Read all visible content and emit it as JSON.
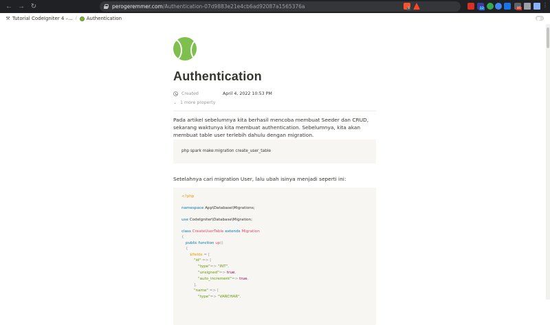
{
  "browser": {
    "url_host": "perogeremmer.com",
    "url_path": "/Authentication-07d9883e21e4cb6ad92087a1565376a",
    "brave_badge": "9",
    "ext_badge_1": "12",
    "ext_badge_2": "80"
  },
  "breadcrumb": {
    "parent": "Tutorial CodeIgniter 4 –...",
    "current": "Authentication"
  },
  "page": {
    "title": "Authentication",
    "properties": [
      {
        "name": "Created",
        "value": "April 4, 2022 10:53 PM"
      }
    ],
    "more_properties": "1 more property",
    "paragraph_1": "Pada artikel sebelumnya kita berhasil mencoba membuat Seeder dan CRUD, sekarang waktunya kita membuat authentication. Sebelumnya, kita akan membuat table user terlebih dahulu dengan migration.",
    "code_1": "php spark make:migration create_user_table",
    "paragraph_2": "Setelahnya cari migration User, lalu ubah isinya menjadi seperti ini:"
  },
  "code_2": {
    "php_open": "<?php",
    "ns_kw": "namespace",
    "ns_val": "App\\Database\\Migrations;",
    "use_kw": "use",
    "use_val": "CodeIgniter\\Database\\Migration;",
    "class_kw": "class",
    "class_name": "CreateUserTable",
    "extends_kw": "extends",
    "parent_class": "Migration",
    "brace_open": "{",
    "fn_kw": "public function",
    "fn_name": "up",
    "fn_parens": "()",
    "fn_brace": "{",
    "fields_var": "$fields",
    "fields_assign": " = [",
    "id_key": "\"id\"",
    "arrow": " => [",
    "type_key": "\"type\"",
    "type_arrow": "=> ",
    "type_int": "\"INT\"",
    "comma": ",",
    "unsigned_key": "\"unsigned\"",
    "unsigned_arrow": "=> ",
    "true_val": "true",
    "auto_key": "\"auto_increment\"",
    "auto_arrow": "=> ",
    "close_bracket": "],",
    "name_key": "\"name\"",
    "name_arrow": " => [",
    "type_varchar": "\"VARCHAR\""
  }
}
